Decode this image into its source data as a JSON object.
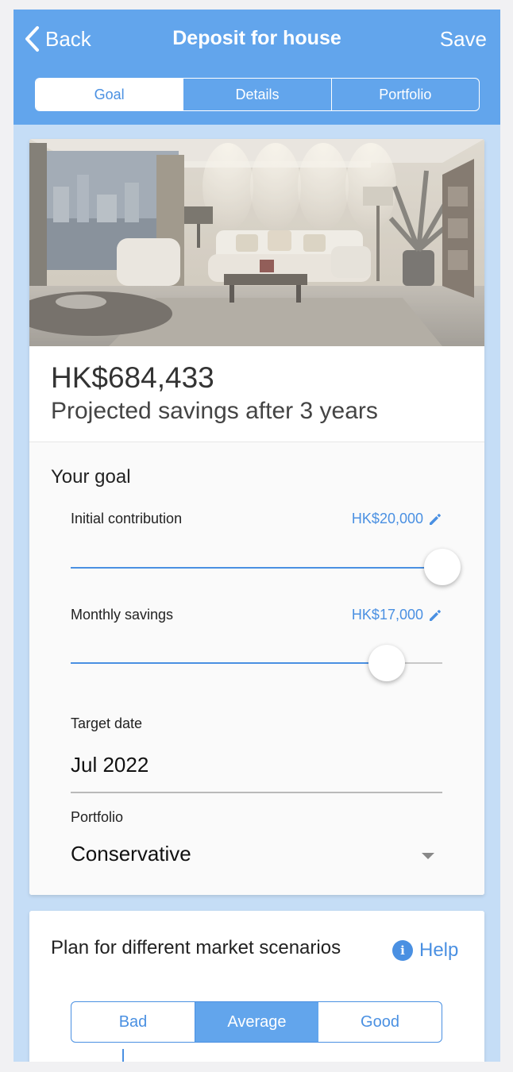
{
  "header": {
    "back_label": "Back",
    "title": "Deposit for house",
    "save_label": "Save",
    "tabs": [
      {
        "label": "Goal",
        "active": true
      },
      {
        "label": "Details",
        "active": false
      },
      {
        "label": "Portfolio",
        "active": false
      }
    ]
  },
  "summary": {
    "amount": "HK$684,433",
    "projection_label": "Projected savings after 3 years"
  },
  "goal": {
    "section_title": "Your goal",
    "initial": {
      "label": "Initial contribution",
      "value": "HK$20,000",
      "slider_fraction": 1.0
    },
    "monthly": {
      "label": "Monthly savings",
      "value": "HK$17,000",
      "slider_fraction": 0.85
    },
    "target_date": {
      "label": "Target date",
      "value": "Jul 2022"
    },
    "portfolio": {
      "label": "Portfolio",
      "value": "Conservative"
    }
  },
  "scenarios": {
    "title": "Plan for different market scenarios",
    "help_label": "Help",
    "options": [
      {
        "label": "Bad",
        "active": false
      },
      {
        "label": "Average",
        "active": true
      },
      {
        "label": "Good",
        "active": false
      }
    ]
  },
  "colors": {
    "accent": "#4a90e2",
    "header": "#62a5ec",
    "background": "#c5ddf6"
  }
}
